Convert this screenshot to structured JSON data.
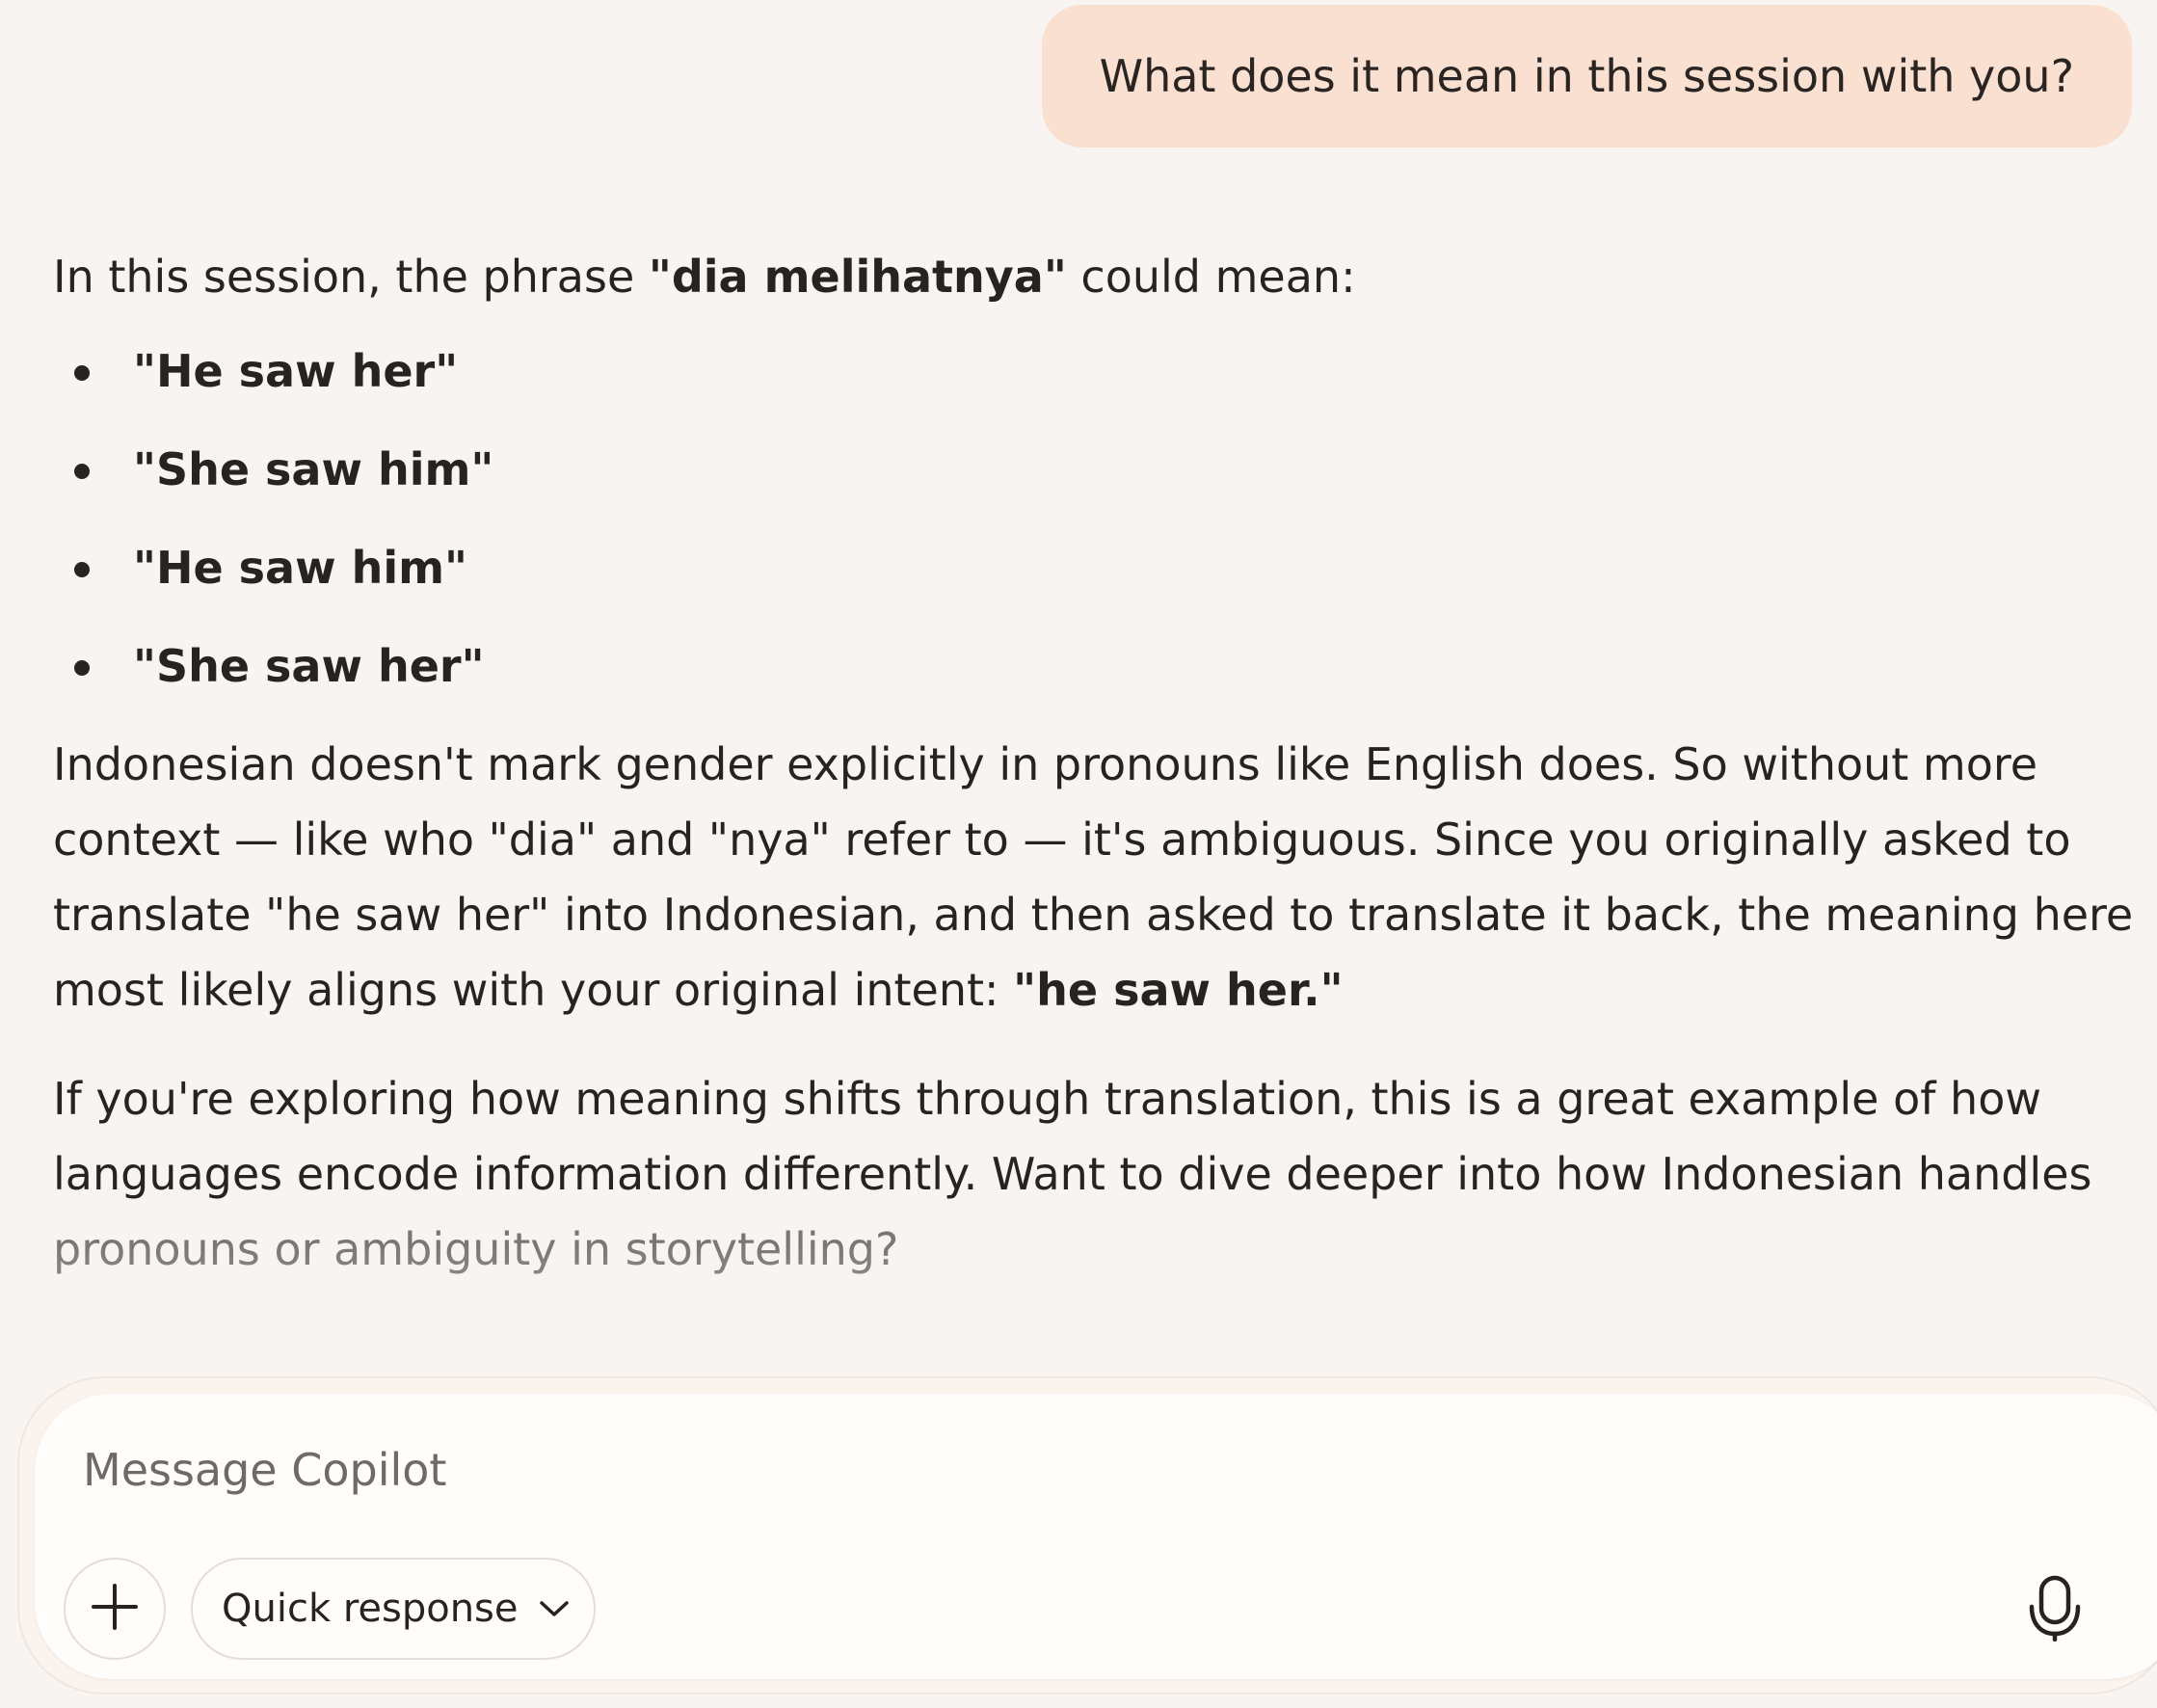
{
  "user_message": {
    "text": "What does it mean in this session with you?"
  },
  "assistant_message": {
    "intro_before": "In this session, the phrase ",
    "intro_bold": "\"dia melihatnya\"",
    "intro_after": " could mean:",
    "bullets": [
      "\"He saw her\"",
      "\"She saw him\"",
      "\"He saw him\"",
      "\"She saw her\""
    ],
    "para1_text": "Indonesian doesn't mark gender explicitly in pronouns like English does. So without more context — like who \"dia\" and \"nya\" refer to — it's ambiguous. Since you originally asked to translate \"he saw her\" into Indonesian, and then asked to translate it back, the meaning here most likely aligns with your original intent: ",
    "para1_bold": "\"he saw her.\"",
    "para2_text": "If you're exploring how meaning shifts through translation, this is a great example of how languages encode information differently. Want to dive deeper into how Indonesian handles ",
    "para2_faded": "pronouns or ambiguity in storytelling?"
  },
  "composer": {
    "placeholder": "Message Copilot",
    "value": "",
    "mode_label": "Quick response",
    "icons": {
      "add": "plus-icon",
      "mode": "chevron-down-icon",
      "mic": "microphone-icon"
    }
  },
  "colors": {
    "background": "#f8f4f1",
    "user_bubble": "#fae0d1",
    "text": "#262320",
    "placeholder": "#6f6a66"
  }
}
